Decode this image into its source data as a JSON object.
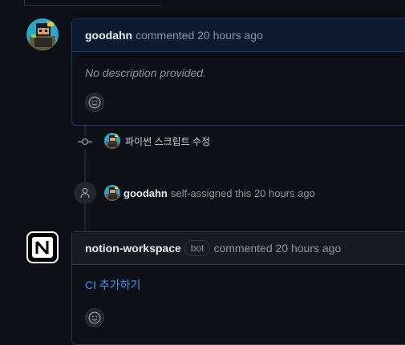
{
  "comment1": {
    "author": "goodahn",
    "verb": "commented 20 hours ago",
    "body": "No description provided."
  },
  "event1": {
    "text": "파이썬 스크립트 수정"
  },
  "event2": {
    "author": "goodahn",
    "text": "self-assigned this 20 hours ago"
  },
  "comment2": {
    "author": "notion-workspace",
    "badge": "bot",
    "verb": "commented 20 hours ago",
    "body": "CI 추가하기"
  },
  "icons": {
    "avatar": "pixel-avatar",
    "commit": "git-commit-icon",
    "person": "person-icon",
    "notion": "notion-logo-icon",
    "emoji": "smiley-icon"
  },
  "colors": {
    "background": "#0d1117",
    "border": "#30363d",
    "link": "#4493f8",
    "self_border": "#1f3b6b"
  }
}
